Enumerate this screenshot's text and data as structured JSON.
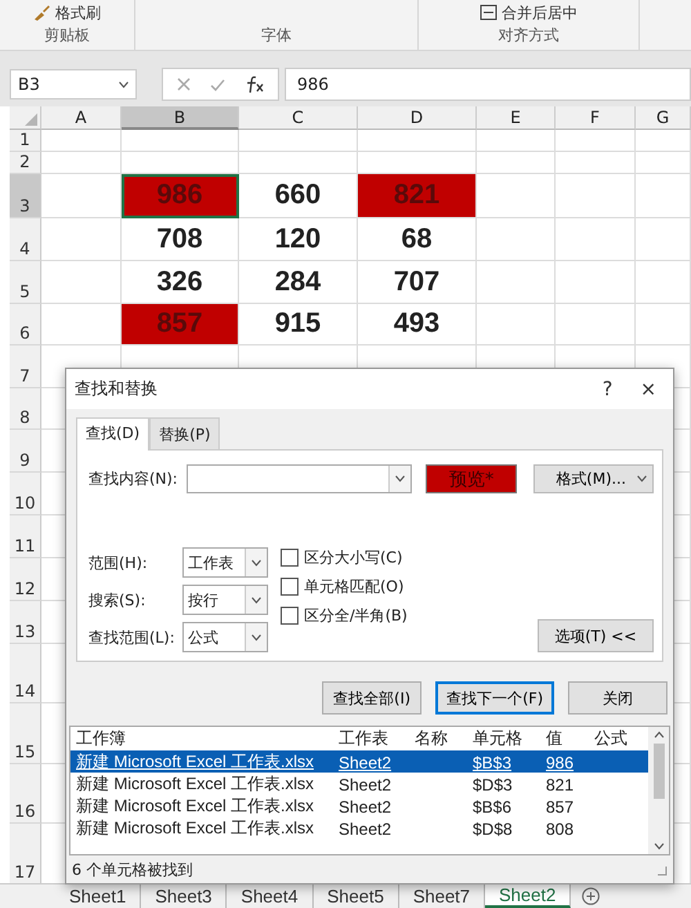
{
  "ribbon": {
    "groups": [
      {
        "label": "剪贴板",
        "buttons": [
          "格式刷"
        ]
      },
      {
        "label": "字体"
      },
      {
        "label": "对齐方式",
        "buttons": [
          "合并后居中"
        ]
      }
    ]
  },
  "formula_bar": {
    "name_box": "B3",
    "value": "986"
  },
  "sheet": {
    "columns": [
      {
        "label": "A",
        "selected": false
      },
      {
        "label": "B",
        "selected": true
      },
      {
        "label": "C",
        "selected": false
      },
      {
        "label": "D",
        "selected": false
      },
      {
        "label": "E",
        "selected": false
      },
      {
        "label": "F",
        "selected": false
      },
      {
        "label": "G",
        "selected": false
      }
    ],
    "rows": [
      {
        "header": "1",
        "selected": false
      },
      {
        "header": "2",
        "selected": false
      },
      {
        "header": "3",
        "selected": true,
        "cells": [
          {
            "value": "986",
            "highlighted": true,
            "active": true
          },
          {
            "value": "660",
            "highlighted": false,
            "active": false
          },
          {
            "value": "821",
            "highlighted": true,
            "active": false
          }
        ]
      },
      {
        "header": "4",
        "selected": false,
        "cells": [
          {
            "value": "708",
            "highlighted": false,
            "active": false
          },
          {
            "value": "120",
            "highlighted": false,
            "active": false
          },
          {
            "value": "68",
            "highlighted": false,
            "active": false
          }
        ]
      },
      {
        "header": "5",
        "selected": false,
        "cells": [
          {
            "value": "326",
            "highlighted": false,
            "active": false
          },
          {
            "value": "284",
            "highlighted": false,
            "active": false
          },
          {
            "value": "707",
            "highlighted": false,
            "active": false
          }
        ]
      },
      {
        "header": "6",
        "selected": false,
        "cells": [
          {
            "value": "857",
            "highlighted": true,
            "active": false
          },
          {
            "value": "915",
            "highlighted": false,
            "active": false
          },
          {
            "value": "493",
            "highlighted": false,
            "active": false
          }
        ]
      },
      {
        "header": "7",
        "selected": false
      },
      {
        "header": "8",
        "selected": false
      },
      {
        "header": "9",
        "selected": false
      },
      {
        "header": "10",
        "selected": false
      },
      {
        "header": "11",
        "selected": false
      },
      {
        "header": "12",
        "selected": false
      },
      {
        "header": "13",
        "selected": false
      },
      {
        "header": "14",
        "selected": false
      },
      {
        "header": "15",
        "selected": false
      },
      {
        "header": "16",
        "selected": false
      },
      {
        "header": "17",
        "selected": false
      }
    ]
  },
  "dialog": {
    "title": "查找和替换",
    "help": "?",
    "close": "×",
    "tabs": [
      {
        "label": "查找(D)",
        "selected": true
      },
      {
        "label": "替换(P)",
        "selected": false
      }
    ],
    "find_label": "查找内容(N):",
    "preview": "预览*",
    "format_button": "格式(M)...",
    "selects": [
      {
        "label": "范围(H):",
        "value": "工作表"
      },
      {
        "label": "搜索(S):",
        "value": "按行"
      },
      {
        "label": "查找范围(L):",
        "value": "公式"
      }
    ],
    "options": [
      {
        "label": "区分大小写(C)",
        "checked": false
      },
      {
        "label": "单元格匹配(O)",
        "checked": false
      },
      {
        "label": "区分全/半角(B)",
        "checked": false
      }
    ],
    "options_button": "选项(T) <<",
    "buttons": [
      {
        "label": "查找全部(I)",
        "focused": false
      },
      {
        "label": "查找下一个(F)",
        "focused": true
      },
      {
        "label": "关闭",
        "focused": false
      }
    ],
    "results": {
      "columns": [
        "工作簿",
        "工作表",
        "名称",
        "单元格",
        "值",
        "公式"
      ],
      "rows": [
        {
          "workbook": "新建 Microsoft Excel 工作表.xlsx",
          "sheet": "Sheet2",
          "cell": "$B$3",
          "value": "986",
          "selected": true
        },
        {
          "workbook": "新建 Microsoft Excel 工作表.xlsx",
          "sheet": "Sheet2",
          "cell": "$D$3",
          "value": "821",
          "selected": false
        },
        {
          "workbook": "新建 Microsoft Excel 工作表.xlsx",
          "sheet": "Sheet2",
          "cell": "$B$6",
          "value": "857",
          "selected": false
        },
        {
          "workbook": "新建 Microsoft Excel 工作表.xlsx",
          "sheet": "Sheet2",
          "cell": "$D$8",
          "value": "808",
          "selected": false
        }
      ]
    },
    "status": "6 个单元格被找到"
  },
  "sheet_tabs": [
    {
      "label": "Sheet1",
      "selected": false
    },
    {
      "label": "Sheet3",
      "selected": false
    },
    {
      "label": "Sheet4",
      "selected": false
    },
    {
      "label": "Sheet5",
      "selected": false
    },
    {
      "label": "Sheet7",
      "selected": false
    },
    {
      "label": "Sheet2",
      "selected": true
    }
  ]
}
